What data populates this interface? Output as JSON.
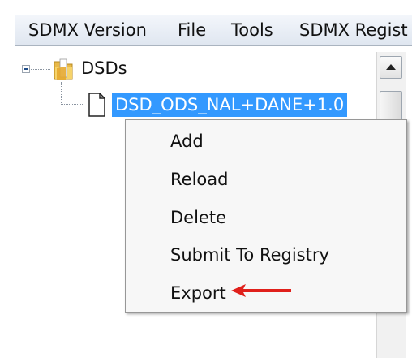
{
  "menubar": {
    "items": [
      "SDMX Version",
      "File",
      "Tools",
      "SDMX Regist"
    ]
  },
  "tree": {
    "root_label": "DSDs",
    "child_label": "DSD_ODS_NAL+DANE+1.0"
  },
  "context_menu": {
    "items": [
      "Add",
      "Reload",
      "Delete",
      "Submit To Registry",
      "Export"
    ]
  },
  "annotation": {
    "arrow_color": "#e0201b"
  },
  "icons": {
    "expander": "minus-expander-icon",
    "folder": "folder-icon",
    "document": "document-icon",
    "scroll_up": "scroll-up-arrow-icon"
  }
}
